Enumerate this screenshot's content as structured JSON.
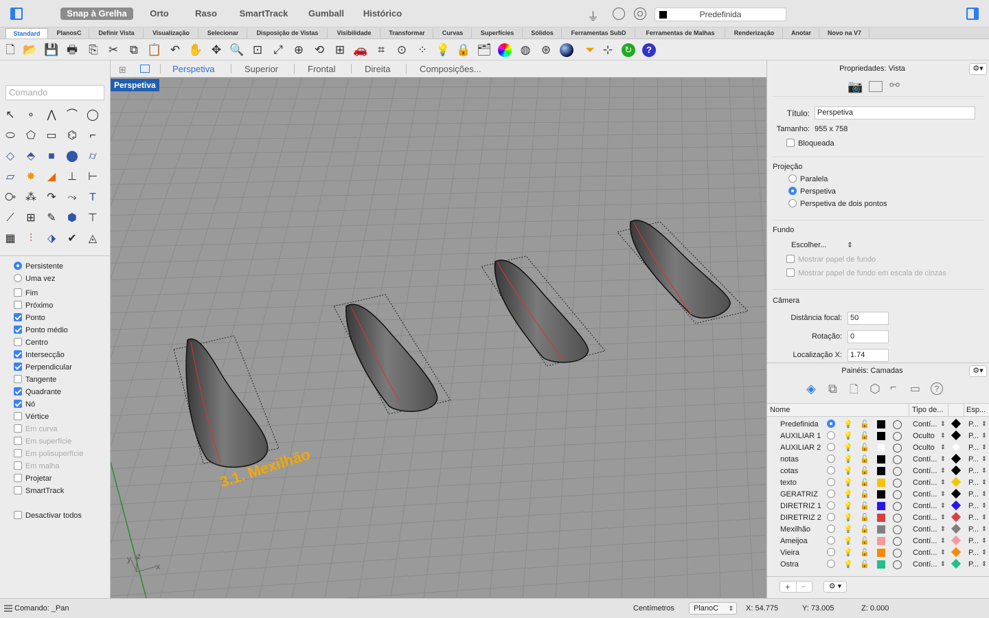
{
  "titlebar": {
    "buttons": [
      "Snap à Grelha",
      "Orto",
      "Raso",
      "SmartTrack",
      "Gumball",
      "Histórico"
    ],
    "layer_select": "Predefinida"
  },
  "tabs": [
    "Standard",
    "PlanosC",
    "Definir Vista",
    "Visualização",
    "Selecionar",
    "Disposição de Vistas",
    "Visibilidade",
    "Transformar",
    "Curvas",
    "Superfícies",
    "Sólidos",
    "Ferramentas SubD",
    "Ferramentas de Malhas",
    "Renderização",
    "Anotar",
    "Novo na V7"
  ],
  "command": {
    "placeholder": "Comando"
  },
  "osnap": {
    "modes": [
      "Persistente",
      "Uma vez"
    ],
    "items": [
      {
        "label": "Fim",
        "checked": false,
        "enabled": true
      },
      {
        "label": "Próximo",
        "checked": false,
        "enabled": true
      },
      {
        "label": "Ponto",
        "checked": true,
        "enabled": true
      },
      {
        "label": "Ponto médio",
        "checked": true,
        "enabled": true
      },
      {
        "label": "Centro",
        "checked": false,
        "enabled": true
      },
      {
        "label": "Intersecção",
        "checked": true,
        "enabled": true
      },
      {
        "label": "Perpendicular",
        "checked": true,
        "enabled": true
      },
      {
        "label": "Tangente",
        "checked": false,
        "enabled": true
      },
      {
        "label": "Quadrante",
        "checked": true,
        "enabled": true
      },
      {
        "label": "Nó",
        "checked": true,
        "enabled": true
      },
      {
        "label": "Vértice",
        "checked": false,
        "enabled": true
      },
      {
        "label": "Em curva",
        "checked": false,
        "enabled": false
      },
      {
        "label": "Em superfície",
        "checked": false,
        "enabled": false
      },
      {
        "label": "Em polisuperfície",
        "checked": false,
        "enabled": false
      },
      {
        "label": "Em malha",
        "checked": false,
        "enabled": false
      },
      {
        "label": "Projetar",
        "checked": false,
        "enabled": true
      },
      {
        "label": "SmartTrack",
        "checked": false,
        "enabled": true
      }
    ],
    "disable_all": "Desactivar todos"
  },
  "viewport_tabs": [
    "Perspetiva",
    "Superior",
    "Frontal",
    "Direita",
    "Composições..."
  ],
  "viewport": {
    "label": "Perspetiva",
    "annotation": "3.1. Mexilhão",
    "axis_x": "x",
    "axis_y": "y",
    "axis_z": "z"
  },
  "properties": {
    "title": "Propriedades: Vista",
    "titulo_label": "Título:",
    "titulo_value": "Perspetiva",
    "tamanho_label": "Tamanho:",
    "tamanho_value": "955 x 758",
    "bloqueada": "Bloqueada",
    "projecao_label": "Projeção",
    "projecao_options": [
      "Paralela",
      "Perspetiva",
      "Perspetiva de dois pontos"
    ],
    "fundo_label": "Fundo",
    "fundo_select": "Escolher...",
    "fundo_options": [
      "Mostrar papel de fundo",
      "Mostrar papel de fundo em escala de cinzas"
    ],
    "camera_label": "Câmera",
    "distancia_label": "Distância focal:",
    "distancia_value": "50",
    "rotacao_label": "Rotação:",
    "rotacao_value": "0",
    "localizacao_label": "Localização X:",
    "localizacao_value": "1.74"
  },
  "layers": {
    "title": "Painéis: Camadas",
    "headers": [
      "Nome",
      "Tipo de...",
      "Esp..."
    ],
    "rows": [
      {
        "name": "Predefinida",
        "current": true,
        "color": "#000000",
        "linetype": "Contí...",
        "print": "#000000",
        "plabel": "P..."
      },
      {
        "name": "AUXILIAR 1",
        "current": false,
        "color": "#000000",
        "linetype": "Oculto",
        "print": "#000000",
        "plabel": "P..."
      },
      {
        "name": "AUXILIAR 2",
        "current": false,
        "color": "#ffffff",
        "linetype": "Oculto",
        "print": "#ffffff",
        "plabel": "P..."
      },
      {
        "name": "notas",
        "current": false,
        "color": "#000000",
        "linetype": "Contí...",
        "print": "#000000",
        "plabel": "P..."
      },
      {
        "name": "cotas",
        "current": false,
        "color": "#000000",
        "linetype": "Contí...",
        "print": "#000000",
        "plabel": "P..."
      },
      {
        "name": "texto",
        "current": false,
        "color": "#f5c400",
        "linetype": "Contí...",
        "print": "#f5c400",
        "plabel": "P..."
      },
      {
        "name": "GERATRIZ",
        "current": false,
        "color": "#000000",
        "linetype": "Contí...",
        "print": "#000000",
        "plabel": "P..."
      },
      {
        "name": "DIRETRIZ 1",
        "current": false,
        "color": "#2a14f0",
        "linetype": "Contí...",
        "print": "#2a14f0",
        "plabel": "P..."
      },
      {
        "name": "DIRETRIZ 2",
        "current": false,
        "color": "#d94040",
        "linetype": "Contí...",
        "print": "#d94040",
        "plabel": "P..."
      },
      {
        "name": "Mexilhão",
        "current": false,
        "color": "#808080",
        "linetype": "Contí...",
        "print": "#808080",
        "plabel": "P..."
      },
      {
        "name": "Ameijoa",
        "current": false,
        "color": "#f49a9a",
        "linetype": "Contí...",
        "print": "#f49a9a",
        "plabel": "P..."
      },
      {
        "name": "Vieira",
        "current": false,
        "color": "#f58a0a",
        "linetype": "Contí...",
        "print": "#f58a0a",
        "plabel": "P..."
      },
      {
        "name": "Ostra",
        "current": false,
        "color": "#1fc08a",
        "linetype": "Contí...",
        "print": "#1fc08a",
        "plabel": "P..."
      }
    ]
  },
  "status": {
    "command": "Comando: _Pan",
    "units": "Centímetros",
    "cplane": "PlanoC",
    "x": "X: 54.775",
    "y": "Y: 73.005",
    "z": "Z: 0.000"
  }
}
